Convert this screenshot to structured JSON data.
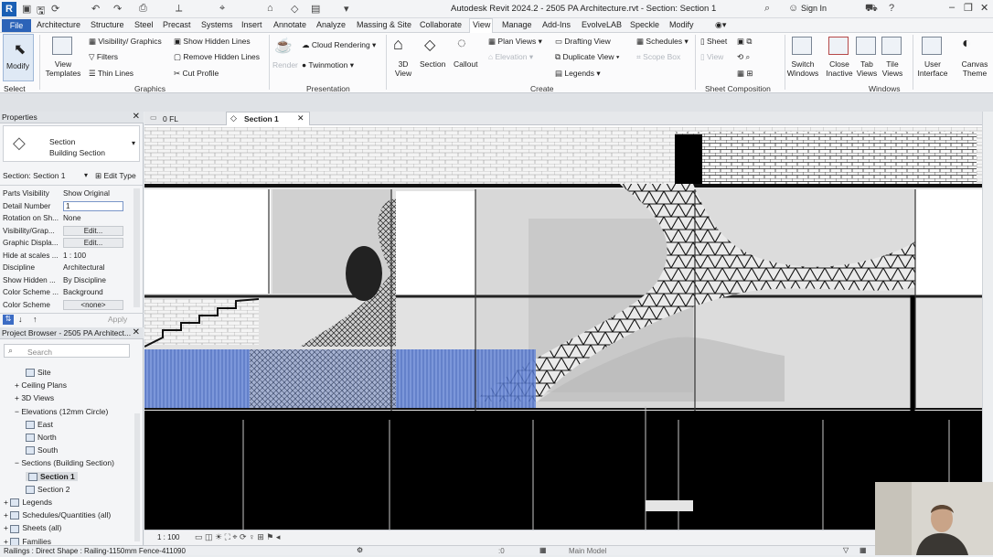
{
  "app": {
    "window_title": "Autodesk Revit 2024.2 - 2505 PA Architecture.rvt - Section: Section 1",
    "sign_in": "Sign In",
    "logo_letter": "R"
  },
  "ribbon_tabs": [
    "File",
    "Architecture",
    "Structure",
    "Steel",
    "Precast",
    "Systems",
    "Insert",
    "Annotate",
    "Analyze",
    "Massing & Site",
    "Collaborate",
    "View",
    "Manage",
    "Add-Ins",
    "EvolveLAB",
    "Speckle",
    "Modify"
  ],
  "active_tab": "View",
  "ribbon": {
    "modify": "Modify",
    "select": "Select",
    "view_templates": "View Templates",
    "visibility_graphics": "Visibility/ Graphics",
    "filters": "Filters",
    "thin_lines": "Thin Lines",
    "show_hidden_lines": "Show  Hidden Lines",
    "remove_hidden_lines": "Remove  Hidden Lines",
    "cut_profile": "Cut  Profile",
    "graphics": "Graphics",
    "render": "Render",
    "cloud_rendering": "Cloud  Rendering",
    "twinmotion": "Twinmotion",
    "presentation": "Presentation",
    "view_3d": "3D View",
    "section": "Section",
    "callout": "Callout",
    "plan_views": "Plan  Views",
    "elevation": "Elevation",
    "drafting_view": "Drafting  View",
    "duplicate_view": "Duplicate  View",
    "legends": "Legends",
    "schedules": "Schedules",
    "scope_box": "Scope  Box",
    "create": "Create",
    "sheet": "Sheet",
    "view": "View",
    "sheet_composition": "Sheet Composition",
    "switch_windows": "Switch Windows",
    "close_inactive": "Close Inactive",
    "tab_views": "Tab Views",
    "tile_views": "Tile Views",
    "windows": "Windows",
    "user_interface": "User Interface",
    "canvas_theme": "Canvas Theme"
  },
  "properties": {
    "header": "Properties",
    "type_family": "Section",
    "type_name": "Building Section",
    "instance": "Section: Section 1",
    "edit_type": "Edit Type",
    "rows": [
      {
        "k": "Parts Visibility",
        "v": "Show Original"
      },
      {
        "k": "Detail Number",
        "v": "1"
      },
      {
        "k": "Rotation on Sh...",
        "v": "None"
      },
      {
        "k": "Visibility/Grap...",
        "v": "Edit..."
      },
      {
        "k": "Graphic Displa...",
        "v": "Edit..."
      },
      {
        "k": "Hide at scales ...",
        "v": "1 : 100"
      },
      {
        "k": "Discipline",
        "v": "Architectural"
      },
      {
        "k": "Show Hidden ...",
        "v": "By Discipline"
      },
      {
        "k": "Color Scheme ...",
        "v": "Background"
      },
      {
        "k": "Color Scheme",
        "v": "<none>"
      }
    ],
    "apply": "Apply"
  },
  "project_browser": {
    "header": "Project Browser - 2505 PA Architect...",
    "search_placeholder": "Search",
    "items": [
      {
        "label": "Site",
        "indent": 2,
        "icon": true
      },
      {
        "label": "Ceiling Plans",
        "indent": 1,
        "exp": "+"
      },
      {
        "label": "3D Views",
        "indent": 1,
        "exp": "+"
      },
      {
        "label": "Elevations (12mm Circle)",
        "indent": 1,
        "exp": "−"
      },
      {
        "label": "East",
        "indent": 2,
        "icon": true
      },
      {
        "label": "North",
        "indent": 2,
        "icon": true
      },
      {
        "label": "South",
        "indent": 2,
        "icon": true
      },
      {
        "label": "Sections (Building Section)",
        "indent": 1,
        "exp": "−"
      },
      {
        "label": "Section 1",
        "indent": 2,
        "icon": true,
        "selected": true
      },
      {
        "label": "Section 2",
        "indent": 2,
        "icon": true
      },
      {
        "label": "Legends",
        "indent": 0,
        "exp": "+",
        "icon": true
      },
      {
        "label": "Schedules/Quantities (all)",
        "indent": 0,
        "exp": "+",
        "icon": true
      },
      {
        "label": "Sheets (all)",
        "indent": 0,
        "exp": "+",
        "icon": true
      },
      {
        "label": "Families",
        "indent": 0,
        "exp": "+",
        "icon": true
      }
    ]
  },
  "view_tabs": [
    {
      "label": "0 FL",
      "active": false
    },
    {
      "label": "Section 1",
      "active": true
    }
  ],
  "view_scale": "1 : 100",
  "status": {
    "message": "Railings : Direct Shape : Railing-1150mm Fence-411090",
    "coord": ":0",
    "model": "Main Model"
  }
}
